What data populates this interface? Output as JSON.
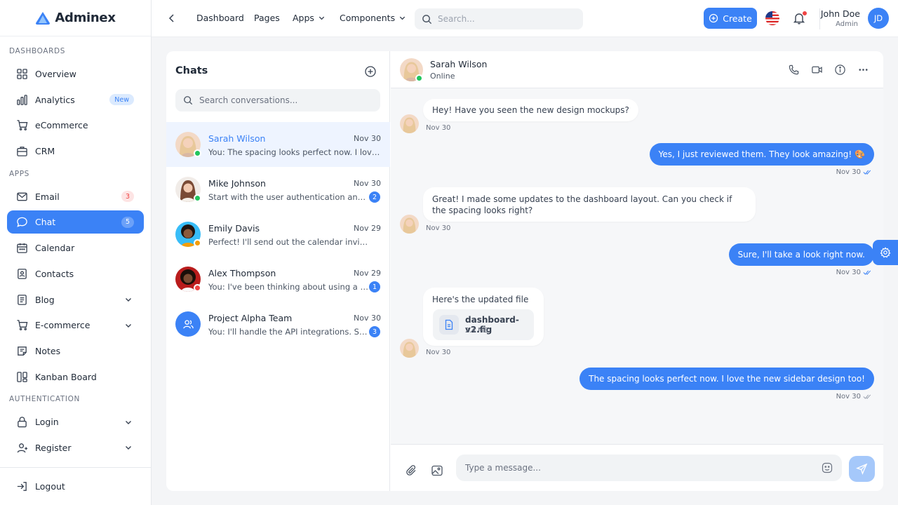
{
  "brand": {
    "name": "Adminex"
  },
  "sidebar": {
    "sections": [
      "DASHBOARDS",
      "APPS",
      "AUTHENTICATION"
    ],
    "dashboards": [
      {
        "label": "Overview"
      },
      {
        "label": "Analytics",
        "badge": "New"
      },
      {
        "label": "eCommerce"
      },
      {
        "label": "CRM"
      }
    ],
    "apps": [
      {
        "label": "Email",
        "badge": "3"
      },
      {
        "label": "Chat",
        "badge": "5"
      },
      {
        "label": "Calendar"
      },
      {
        "label": "Contacts"
      },
      {
        "label": "Blog"
      },
      {
        "label": "E-commerce"
      },
      {
        "label": "Notes"
      },
      {
        "label": "Kanban Board"
      }
    ],
    "auth": [
      {
        "label": "Login"
      },
      {
        "label": "Register"
      }
    ],
    "logout": "Logout"
  },
  "topbar": {
    "links": [
      "Dashboard",
      "Pages",
      "Apps",
      "Components"
    ],
    "search_placeholder": "Search...",
    "create_label": "Create",
    "user": {
      "name": "John Doe",
      "role": "Admin",
      "initials": "JD"
    }
  },
  "chats": {
    "title": "Chats",
    "search_placeholder": "Search conversations...",
    "conversations": [
      {
        "name": "Sarah Wilson",
        "date": "Nov 30",
        "preview": "You: The spacing looks perfect now. I love the new sidebar design too!",
        "status_color": "#22c55e"
      },
      {
        "name": "Mike Johnson",
        "date": "Nov 30",
        "preview": "Start with the user authentication and the dashboard",
        "unread": "2",
        "status_color": "#22c55e"
      },
      {
        "name": "Emily Davis",
        "date": "Nov 29",
        "preview": "Perfect! I'll send out the calendar invite.",
        "status_color": "#f59e0b"
      },
      {
        "name": "Alex Thompson",
        "date": "Nov 29",
        "preview": "You: I've been thinking about using a microservices approach",
        "unread": "1",
        "status_color": "#ef4444"
      },
      {
        "name": "Project Alpha Team",
        "date": "Nov 30",
        "preview": "You: I'll handle the API integrations. Should be done by Friday",
        "unread": "3"
      }
    ]
  },
  "conversation": {
    "contact_name": "Sarah Wilson",
    "contact_status": "Online",
    "messages": [
      {
        "dir": "in",
        "text": "Hey! Have you seen the new design mockups?",
        "time": "Nov 30"
      },
      {
        "dir": "out",
        "text": "Yes, I just reviewed them. They look amazing! 🎨",
        "time": "Nov 30"
      },
      {
        "dir": "in",
        "text": "Great! I made some updates to the dashboard layout. Can you check if the spacing looks right?",
        "time": "Nov 30"
      },
      {
        "dir": "out",
        "text": "Sure, I'll take a look right now.",
        "time": "Nov 30"
      },
      {
        "dir": "in",
        "text": "Here's the updated file",
        "time": "Nov 30",
        "file": {
          "name": "dashboard-v2.fig",
          "size": "2.4 MB"
        }
      },
      {
        "dir": "out",
        "text": "The spacing looks perfect now. I love the new sidebar design too!",
        "time": "Nov 30"
      }
    ],
    "input_placeholder": "Type a message..."
  },
  "colors": {
    "accent": "#3b82f6",
    "online": "#22c55e",
    "away": "#f59e0b",
    "busy": "#ef4444"
  }
}
